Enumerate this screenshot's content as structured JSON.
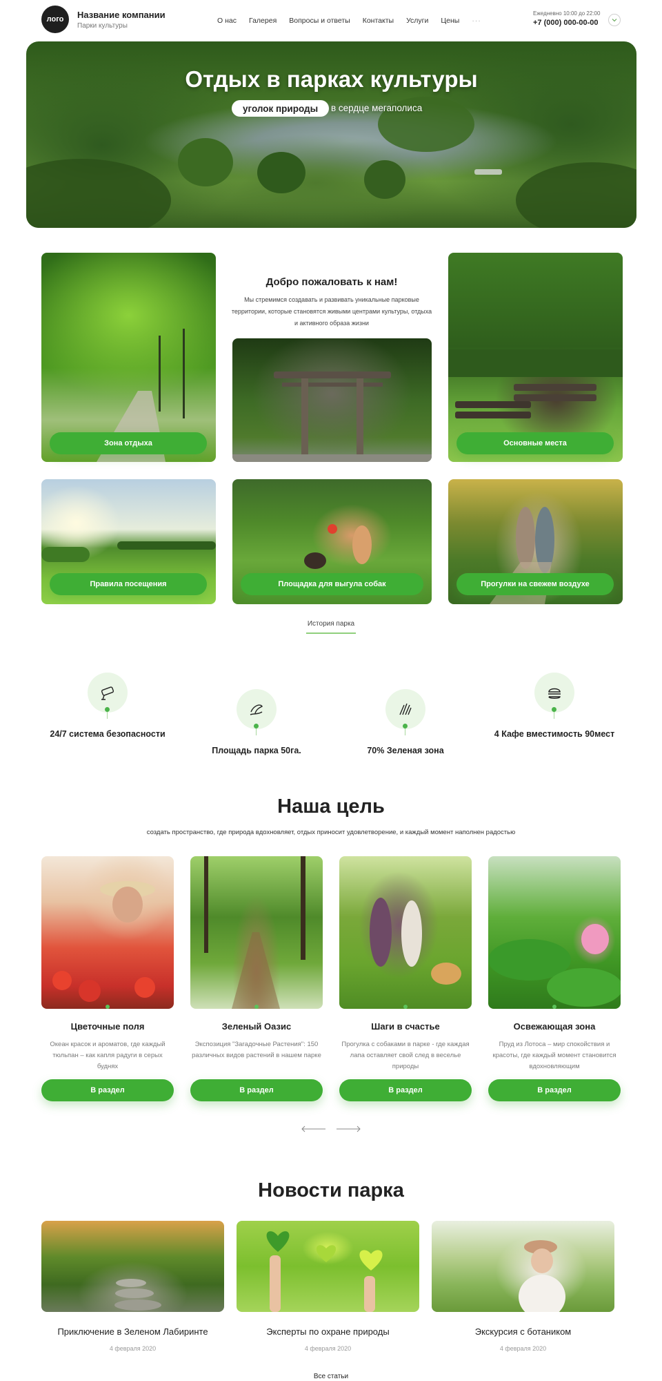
{
  "header": {
    "logo_text": "лого",
    "company_name": "Название компании",
    "company_sub": "Парки культуры",
    "nav": [
      "О нас",
      "Галерея",
      "Вопросы и ответы",
      "Контакты",
      "Услуги",
      "Цены",
      "···"
    ],
    "hours": "Ежедневно 10:00 до 22:00",
    "phone": "+7 (000) 000-00-00"
  },
  "hero": {
    "title": "Отдых в парках культуры",
    "pill": "уголок природы",
    "subtitle": "в сердце мегаполиса"
  },
  "welcome": {
    "title": "Добро пожаловать к нам!",
    "text": "Мы стремимся создавать и развивать уникальные парковые территории, которые становятся живыми центрами культуры, отдыха и активного образа жизни"
  },
  "tiles": [
    {
      "label": "Зона отдыха"
    },
    {
      "label": "Основные места"
    },
    {
      "label": "Правила посещения"
    },
    {
      "label": "Площадка для выгула собак"
    },
    {
      "label": "Прогулки на свежем воздухе"
    }
  ],
  "history_link": "История парка",
  "stats": [
    {
      "text": "24/7 система безопасности",
      "icon": "security-camera-icon"
    },
    {
      "text": "Площадь парка 50га.",
      "icon": "hand-leaf-icon"
    },
    {
      "text": "70%  Зеленая зона",
      "icon": "grass-icon"
    },
    {
      "text": "4 Кафе вместимость 90мест",
      "icon": "burger-icon"
    }
  ],
  "goal": {
    "title": "Наша цель",
    "subtitle": "создать пространство, где природа вдохновляет, отдых приносит удовлетворение, и каждый момент наполнен радостью",
    "cards": [
      {
        "title": "Цветочные поля",
        "desc": "Океан красок и ароматов, где каждый тюльпан – как капля радуги в серых буднях",
        "button": "В раздел"
      },
      {
        "title": "Зеленый Оазис",
        "desc": "Экспозиция \"Загадочные Растения\": 150 различных видов растений в нашем парке",
        "button": "В раздел"
      },
      {
        "title": "Шаги в счастье",
        "desc": "Прогулка с собаками в парке - где каждая лапа оставляет свой след в веселье природы",
        "button": "В раздел"
      },
      {
        "title": "Освежающая зона",
        "desc": "Пруд из Лотоса – мир спокойствия и красоты, где каждый момент становится вдохновляющим",
        "button": "В раздел"
      }
    ]
  },
  "news": {
    "title": "Новости парка",
    "items": [
      {
        "title": "Приключение в Зеленом Лабиринте",
        "date": "4 февраля 2020"
      },
      {
        "title": "Эксперты по охране природы",
        "date": "4 февраля 2020"
      },
      {
        "title": "Экскурсия с ботаником",
        "date": "4 февраля 2020"
      }
    ],
    "all_link": "Все статьи"
  },
  "colors": {
    "accent": "#3fae35",
    "accent_light": "#eaf6e6",
    "text": "#1e1e1e"
  }
}
